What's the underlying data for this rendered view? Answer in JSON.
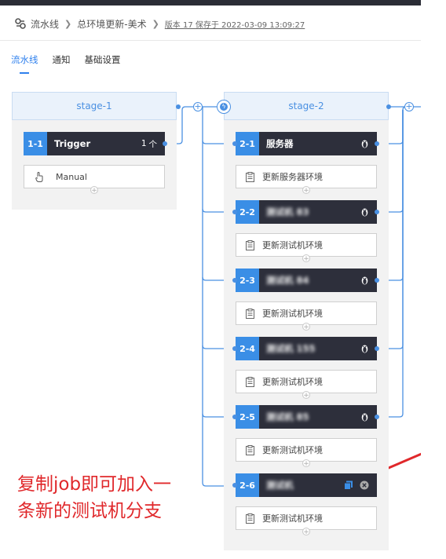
{
  "breadcrumb": {
    "root": "流水线",
    "pipeline": "总环境更新-美术",
    "version": "版本 17 保存于 2022-03-09 13:09:27"
  },
  "tabs": [
    {
      "label": "流水线"
    },
    {
      "label": "通知"
    },
    {
      "label": "基础设置"
    }
  ],
  "stage1": {
    "title": "stage-1",
    "job": {
      "num": "1-1",
      "name": "Trigger",
      "count": "1",
      "arrow": "个"
    },
    "task": "Manual"
  },
  "stage2": {
    "title": "stage-2",
    "jobs": [
      {
        "num": "2-1",
        "name": "服务器",
        "task": "更新服务器环境"
      },
      {
        "num": "2-2",
        "name": "测试机 83",
        "task": "更新测试机环境"
      },
      {
        "num": "2-3",
        "name": "测试机 84",
        "task": "更新测试机环境"
      },
      {
        "num": "2-4",
        "name": "测试机 155",
        "task": "更新测试机环境"
      },
      {
        "num": "2-5",
        "name": "测试机 85",
        "task": "更新测试机环境"
      },
      {
        "num": "2-6",
        "name": "测试机",
        "task": "更新测试机环境"
      }
    ]
  },
  "annotation": {
    "line1": "复制job即可加入一",
    "line2": "条新的测试机分支"
  },
  "colors": {
    "accent": "#3a8ee6",
    "job_bg": "#2d2f3b",
    "annotation": "#e0282b"
  }
}
